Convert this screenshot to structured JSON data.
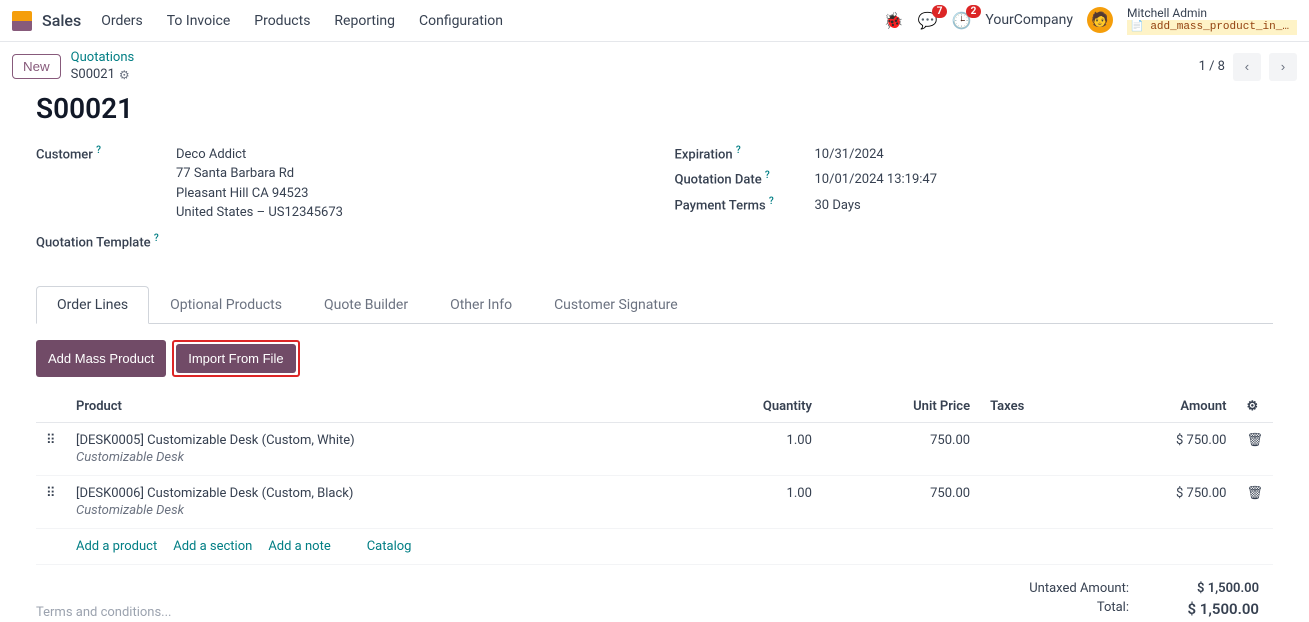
{
  "topbar": {
    "app_name": "Sales",
    "menu": [
      "Orders",
      "To Invoice",
      "Products",
      "Reporting",
      "Configuration"
    ],
    "msg_badge": "7",
    "activity_badge": "2",
    "company": "YourCompany",
    "user_name": "Mitchell Admin",
    "user_script": "add_mass_product_in_sale..."
  },
  "breadcrumb": {
    "new_label": "New",
    "parent": "Quotations",
    "current": "S00021",
    "pager": "1 / 8"
  },
  "header": {
    "title": "S00021"
  },
  "left_fields": {
    "customer_label": "Customer",
    "customer_name": "Deco Addict",
    "customer_addr1": "77 Santa Barbara Rd",
    "customer_addr2": "Pleasant Hill CA 94523",
    "customer_addr3": "United States – US12345673",
    "template_label": "Quotation Template"
  },
  "right_fields": {
    "expiration_label": "Expiration",
    "expiration_value": "10/31/2024",
    "qdate_label": "Quotation Date",
    "qdate_value": "10/01/2024 13:19:47",
    "terms_label": "Payment Terms",
    "terms_value": "30 Days"
  },
  "tabs": [
    "Order Lines",
    "Optional Products",
    "Quote Builder",
    "Other Info",
    "Customer Signature"
  ],
  "buttons": {
    "add_mass": "Add Mass Product",
    "import_file": "Import From File"
  },
  "table": {
    "headers": {
      "product": "Product",
      "qty": "Quantity",
      "price": "Unit Price",
      "taxes": "Taxes",
      "amount": "Amount"
    },
    "rows": [
      {
        "name": "[DESK0005] Customizable Desk (Custom, White)",
        "sub": "Customizable Desk",
        "qty": "1.00",
        "price": "750.00",
        "amount": "$ 750.00"
      },
      {
        "name": "[DESK0006] Customizable Desk (Custom, Black)",
        "sub": "Customizable Desk",
        "qty": "1.00",
        "price": "750.00",
        "amount": "$ 750.00"
      }
    ],
    "add_links": {
      "product": "Add a product",
      "section": "Add a section",
      "note": "Add a note",
      "catalog": "Catalog"
    }
  },
  "footer": {
    "terms_placeholder": "Terms and conditions...",
    "untaxed_label": "Untaxed Amount:",
    "untaxed_value": "$ 1,500.00",
    "total_label": "Total:",
    "total_value": "$ 1,500.00"
  }
}
